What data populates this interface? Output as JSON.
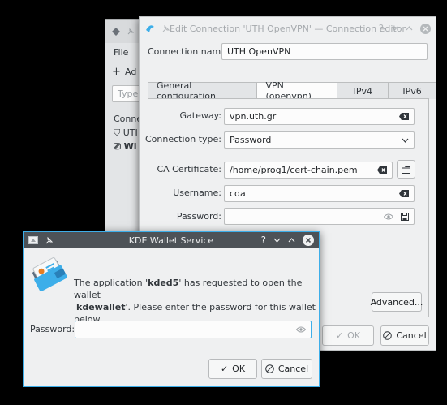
{
  "list_window": {
    "menu_file": "File",
    "add_label": "Ad",
    "search_placeholder": "Type h",
    "column_header": "Conne",
    "row1": "UTI",
    "row2": "Wi"
  },
  "editor": {
    "title": "Edit Connection 'UTH OpenVPN' — Connection editor",
    "connection_name_label": "Connection name:",
    "connection_name_value": "UTH OpenVPN",
    "tabs": [
      "General configuration",
      "VPN (openvpn)",
      "IPv4",
      "IPv6"
    ],
    "active_tab": 1,
    "gateway_label": "Gateway:",
    "gateway_value": "vpn.uth.gr",
    "connection_type_label": "Connection type:",
    "connection_type_value": "Password",
    "ca_label": "CA Certificate:",
    "ca_value": "/home/prog1/cert-chain.pem",
    "username_label": "Username:",
    "username_value": "cda",
    "password_label": "Password:",
    "password_value": "",
    "advanced_label": "Advanced...",
    "ok_label": "OK",
    "cancel_label": "Cancel"
  },
  "wallet": {
    "title": "KDE Wallet Service",
    "message_1": "The application '",
    "app_name": "kded5",
    "message_2": "' has requested to open the wallet",
    "message_3": "'",
    "wallet_name": "kdewallet",
    "message_4": "'. Please enter the password for this wallet below.",
    "password_label": "Password:",
    "password_value": "",
    "ok_label": "OK",
    "cancel_label": "Cancel"
  },
  "colors": {
    "accent": "#3daee9",
    "titlebar_dark": "#4d5257",
    "window_bg": "#eff0f1"
  }
}
